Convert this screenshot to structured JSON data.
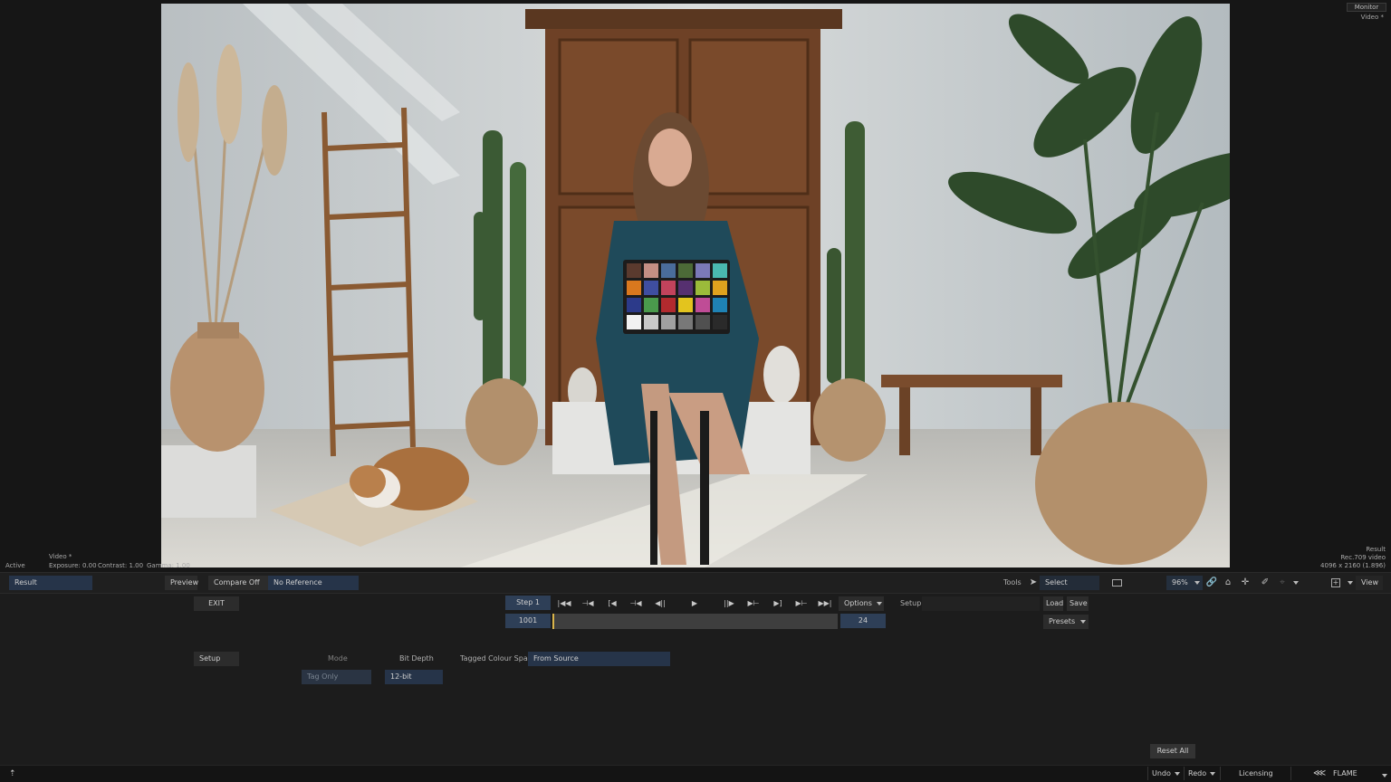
{
  "viewer": {
    "monitor_label": "Monitor",
    "video_label": "Video *",
    "bottom_left": {
      "status": "Active",
      "video": "Video *",
      "exposure": "Exposure: 0.00",
      "contrast": "Contrast: 1.00",
      "gamma": "Gamma: 1.00"
    },
    "bottom_right": {
      "result": "Result",
      "colour_space": "Rec.709 video",
      "resolution": "4096 x 2160 (1.896)"
    },
    "checker_colors": [
      "#5a3a2e",
      "#c48f84",
      "#4a6c9a",
      "#4c6a37",
      "#7b79b8",
      "#4ab9b0",
      "#d9781e",
      "#3f4ea0",
      "#c2435c",
      "#563070",
      "#9bbb3a",
      "#e0a21e",
      "#2c3a8a",
      "#4a9a4c",
      "#b22a2e",
      "#e3c41e",
      "#bf4c96",
      "#1f82b4",
      "#f2f2f2",
      "#c8c8c8",
      "#a0a0a0",
      "#787878",
      "#505050",
      "#2a2a2a"
    ]
  },
  "toolbar": {
    "result": "Result",
    "preview": "Preview",
    "compare": "Compare Off",
    "reference": "No Reference",
    "tools_label": "Tools",
    "select_label": "Select",
    "zoom": "96%",
    "view": "View"
  },
  "panel": {
    "exit": "EXIT",
    "step": "Step 1",
    "frame_start": "1001",
    "frame_end": "24",
    "options": "Options",
    "setup_label": "Setup",
    "load": "Load",
    "save": "Save",
    "presets": "Presets",
    "setup_button": "Setup",
    "mode_label": "Mode",
    "mode_value": "Tag Only",
    "bit_depth_label": "Bit Depth",
    "bit_depth_value": "12-bit",
    "tagged_label": "Tagged Colour Space",
    "tagged_value": "From Source",
    "reset_all": "Reset All"
  },
  "statusbar": {
    "undo": "Undo",
    "redo": "Redo",
    "licensing": "Licensing",
    "brand": "FLAME"
  }
}
